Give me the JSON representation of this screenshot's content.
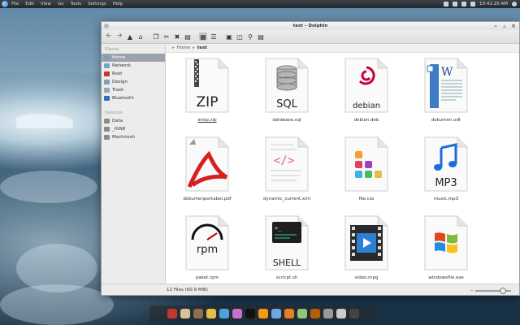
{
  "menubar": {
    "items": [
      "File",
      "Edit",
      "View",
      "Go",
      "Tools",
      "Settings",
      "Help"
    ],
    "clock": "10:41:20 AM"
  },
  "window": {
    "title": "test – Dolphin"
  },
  "toolbar": {
    "icons": [
      "back-icon",
      "forward-icon",
      "up-icon",
      "home-icon",
      "copy-icon",
      "cut-icon",
      "delete-icon",
      "paste-icon",
      "icons-view-icon",
      "details-view-icon",
      "preview-icon",
      "split-icon",
      "search-icon",
      "info-icon"
    ]
  },
  "sidebar": {
    "places_heading": "Places",
    "places": [
      {
        "label": "Home",
        "icon": "home-folder-icon",
        "selected": true
      },
      {
        "label": "Network",
        "icon": "network-icon",
        "selected": false
      },
      {
        "label": "Root",
        "icon": "root-folder-icon",
        "selected": false
      },
      {
        "label": "Design",
        "icon": "folder-icon",
        "selected": false
      },
      {
        "label": "Trash",
        "icon": "trash-icon",
        "selected": false
      },
      {
        "label": "Bluetooth",
        "icon": "bluetooth-icon",
        "selected": false
      }
    ],
    "devices_heading": "Devices",
    "devices": [
      {
        "label": "Data",
        "icon": "drive-icon"
      },
      {
        "label": "_IGN8",
        "icon": "drive-icon"
      },
      {
        "label": "MacIntosh",
        "icon": "drive-icon"
      }
    ]
  },
  "breadcrumb": {
    "home": "Home",
    "current": "test"
  },
  "files": [
    {
      "name": "arsip.zip",
      "label": "ZIP",
      "icon": "zip-icon",
      "underline": true
    },
    {
      "name": "database.sql",
      "label": "SQL",
      "icon": "database-icon",
      "underline": false
    },
    {
      "name": "debian.deb",
      "label": "debian",
      "icon": "debian-icon",
      "underline": false
    },
    {
      "name": "dokumen.odt",
      "label": "",
      "icon": "word-document-icon",
      "underline": false
    },
    {
      "name": "dokumenportabel.pdf",
      "label": "",
      "icon": "pdf-icon",
      "underline": false
    },
    {
      "name": "dynamic_current.xml",
      "label": "",
      "icon": "xml-icon",
      "underline": false
    },
    {
      "name": "file.css",
      "label": "",
      "icon": "css-icon",
      "underline": false
    },
    {
      "name": "music.mp3",
      "label": "MP3",
      "icon": "music-icon",
      "underline": false
    },
    {
      "name": "paket.rpm",
      "label": "rpm",
      "icon": "rpm-icon",
      "underline": false
    },
    {
      "name": "scricpt.sh",
      "label": "SHELL",
      "icon": "terminal-icon",
      "underline": false
    },
    {
      "name": "video.mpg",
      "label": "",
      "icon": "video-icon",
      "underline": false
    },
    {
      "name": "windowsfile.exe",
      "label": "",
      "icon": "windows-icon",
      "underline": false
    }
  ],
  "statusbar": {
    "text": "12 Files (60.9 MiB)",
    "zoom_fraction": 0.8
  },
  "dock": {
    "icons": [
      "anchor-icon",
      "files-icon",
      "gimp-icon",
      "chrome-icon",
      "browser-icon",
      "gear-icon",
      "terminal-icon",
      "vlc-icon",
      "writer-icon",
      "impress-icon",
      "calc-icon",
      "archive-icon",
      "camera-icon",
      "music-icon",
      "monitor-icon"
    ],
    "colors": [
      "#c0392b",
      "#d9c29a",
      "#8e6f4f",
      "#e2c044",
      "#4aa3df",
      "#c96fd0",
      "#111111",
      "#f39c12",
      "#6fa8dc",
      "#e67e22",
      "#93c47d",
      "#b45f06",
      "#999999",
      "#cccccc",
      "#444444"
    ]
  }
}
